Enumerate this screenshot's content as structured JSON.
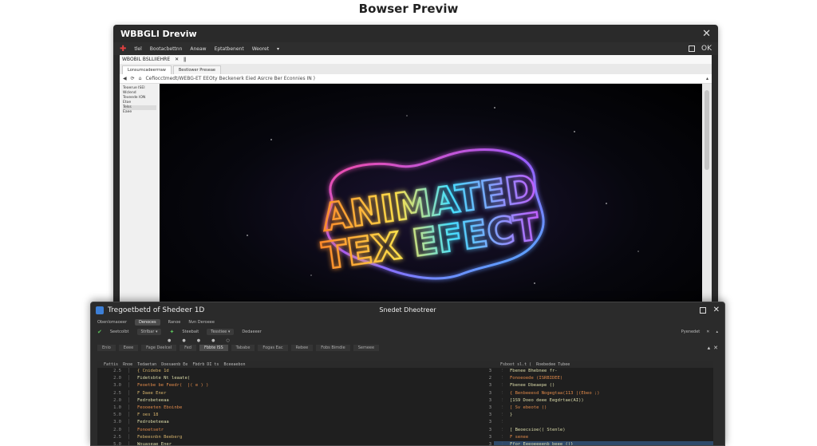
{
  "page_title": "Bowser Previw",
  "back_window": {
    "title": "WBBGLl Dreviw",
    "close_glyph": "✕",
    "toolbar": [
      "tlel",
      "Bootacbettnn",
      "Aneaw",
      "Eptatbenent",
      "Weoret"
    ],
    "toolbar_right": "OK",
    "inner_head": [
      "WBOBIL BSLLIIEHRE",
      "✕",
      "ǁ"
    ],
    "inner_tabs": [
      "Lonsumcadeerrraw",
      "Bestlower Preseae"
    ],
    "address": "Cefiocctmedt/WEBG-ET EEOty Beckenerk Eied Asrcre Ber Econnies IN )",
    "sidebar": [
      "Teoerue ISEI",
      "Wclend",
      "Teveede ION",
      "Etoe",
      "Telss",
      "Eaee"
    ],
    "canvas_line1": "ANIMATED",
    "canvas_line2": "TEX EFECT"
  },
  "front_window": {
    "title": "Tregoetbetd of Shedeer 1D",
    "center_title": "Snedet Dheotreer",
    "menu": [
      "Obenlomaoeer",
      "Denoces",
      "Ranoe",
      "Nvn Deroeee"
    ],
    "toolbar": [
      "Seetcolbt",
      "Strlbar ▾",
      "Steebait",
      "Tesstiee ▾",
      "Dedaeeer"
    ],
    "toolbar_right": [
      "Pyenedet",
      "✕",
      "▴"
    ],
    "dots": [
      "●",
      "●",
      "●",
      "●",
      "○"
    ],
    "panel_tabs": [
      "Enio",
      "Eeee",
      "Fage Deelcel",
      "Fed",
      "Fbbte ISS",
      "Tababe",
      "Fogas Eac",
      "Rebee",
      "Fobs Bimdie",
      "Semeee"
    ],
    "panel_tabs_right": [
      "▴",
      "✕"
    ],
    "left_pane": {
      "header": [
        "Fattis",
        "Rnoe",
        "Tedaetan",
        "Doesaenb Ee",
        "Fbdrb DI ts",
        "Bceeaebon"
      ],
      "lines": [
        {
          "n": "2.5",
          "t": "{ Cnidebe 1d",
          "r": "3"
        },
        {
          "n": "2.0",
          "t": "Fidetsbte Nt leaate(",
          "r": "2"
        },
        {
          "n": "3.0",
          "t": "Feoetbe be Feedr(  |( e ) )",
          "r": "3"
        },
        {
          "n": "2.5",
          "t": "F Daee Ener",
          "r": "3"
        },
        {
          "n": "2.0",
          "t": "Fedrobeteeaa",
          "r": "3"
        },
        {
          "n": "1.0",
          "t": "Feooeeten Eboinbe",
          "r": "3"
        },
        {
          "n": "5.0",
          "t": "F oes 18",
          "r": "3"
        },
        {
          "n": "3.0",
          "t": "Fedrobeteeaa",
          "r": "3"
        },
        {
          "n": "2.0",
          "t": "Fonoetsetr",
          "r": "3"
        },
        {
          "n": "2.5",
          "t": "Febeesnbn Beeberg",
          "r": "3"
        },
        {
          "n": "5.0",
          "t": "Wouaseae Ener",
          "r": "3"
        }
      ]
    },
    "right_pane": {
      "header": [
        "Fsboot sl.t (",
        "Roebedee Tubee"
      ],
      "lines": [
        {
          "t": "Fbenee Bhebnee fr-",
          "hl": false
        },
        {
          "t": "Fonoeoede (ISRBIDEE)",
          "hl": false
        },
        {
          "t": "Fbenee Dbeaepe ()",
          "hl": false
        },
        {
          "t": "{ Benbeeesd Nogegtaa(113 |(Ebeo ;)",
          "hl": false
        },
        {
          "t": "[1S9 Doeo deee Eegdrtae(AI))",
          "hl": false
        },
        {
          "t": "[ Sv ebeote ()",
          "hl": false
        },
        {
          "t": "}",
          "hl": false
        },
        {
          "t": "",
          "hl": false
        },
        {
          "t": "[ Beoecsioe(( Stenle)",
          "hl": false
        },
        {
          "t": "F senee",
          "hl": false
        },
        {
          "t": "Ffor Eeeoeeeenb beee ()}",
          "hl": true
        }
      ]
    }
  },
  "colors": {
    "accent": "#3d7fd6",
    "code_keyword": "#d4b16a",
    "code_string": "#e08a4a"
  }
}
